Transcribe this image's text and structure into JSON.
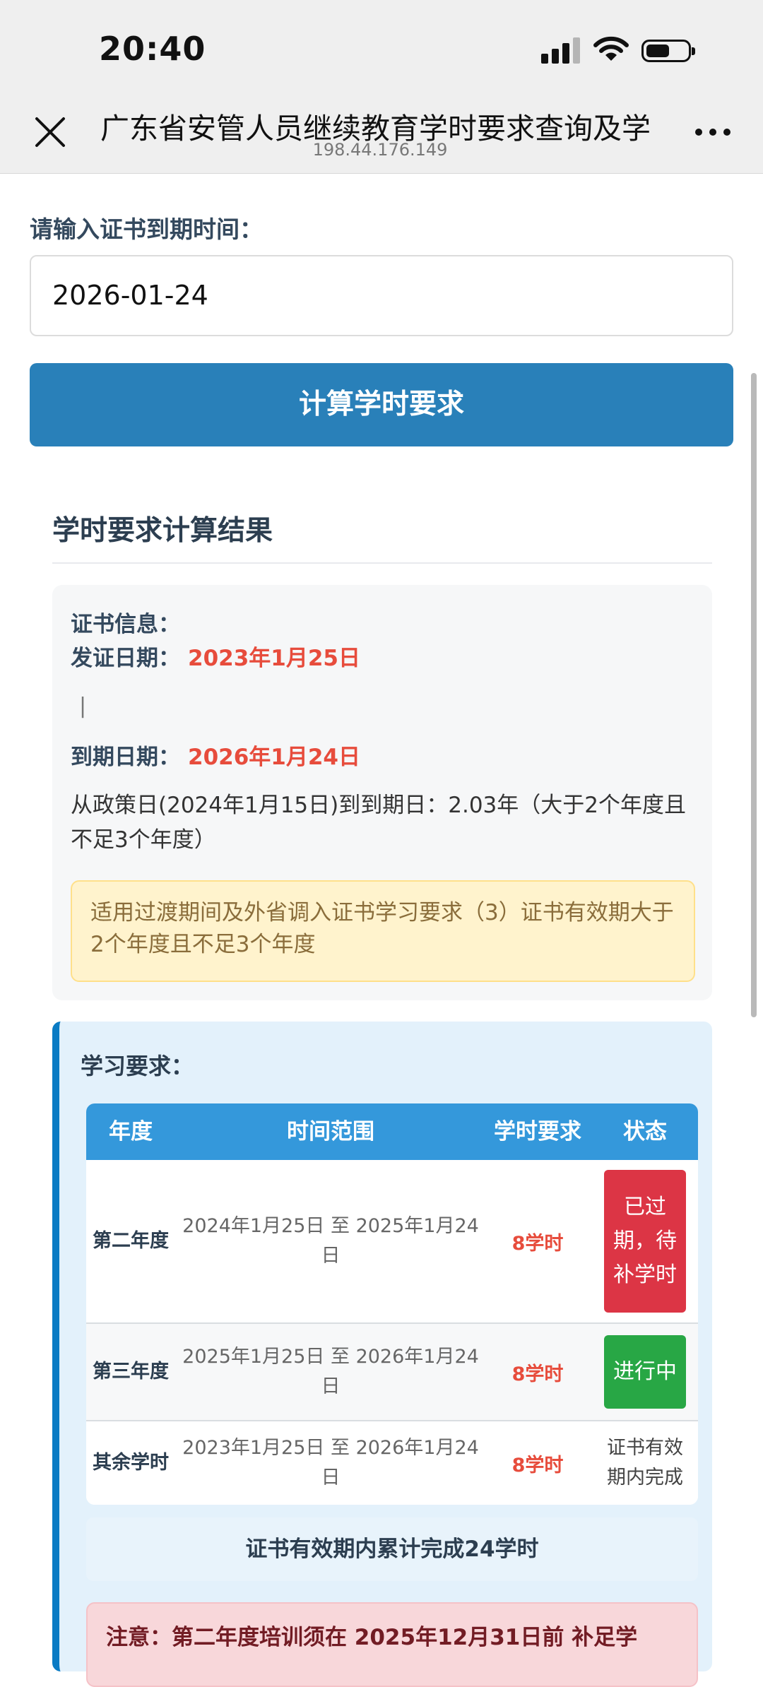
{
  "status_bar": {
    "time": "20:40"
  },
  "browser": {
    "title": "广东省安管人员继续教育学时要求查询及学",
    "url": "198.44.176.149"
  },
  "form": {
    "label": "请输入证书到期时间：",
    "date_value": "2026-01-24",
    "submit_label": "计算学时要求"
  },
  "result": {
    "title": "学时要求计算结果",
    "cert": {
      "heading": "证书信息：",
      "issue_label": "发证日期：",
      "issue_date": "2023年1月25日",
      "separator": "|",
      "expiry_label": "到期日期：",
      "expiry_date": "2026年1月24日",
      "policy_text": "从政策日(2024年1月15日)到到期日：2.03年（大于2个年度且不足3个年度）",
      "warning": "适用过渡期间及外省调入证书学习要求（3）证书有效期大于2个年度且不足3个年度"
    },
    "study": {
      "heading": "学习要求：",
      "columns": [
        "年度",
        "时间范围",
        "学时要求",
        "状态"
      ],
      "rows": [
        {
          "year": "第二年度",
          "range": "2024年1月25日 至 2025年1月24日",
          "hours": "8学时",
          "status": "已过期，待补学时"
        },
        {
          "year": "第三年度",
          "range": "2025年1月25日 至 2026年1月24日",
          "hours": "8学时",
          "status": "进行中"
        },
        {
          "year": "其余学时",
          "range": "2023年1月25日 至 2026年1月24日",
          "hours": "8学时",
          "status": "证书有效期内完成"
        }
      ],
      "total": "证书有效期内累计完成24学时",
      "note": "注意：第二年度培训须在 2025年12月31日前 补足学"
    }
  },
  "colors": {
    "primary_button": "#2980b9",
    "table_header": "#3498db",
    "accent_red": "#e74c3c",
    "status_expired": "#dc3545",
    "status_active": "#28a745",
    "warning_bg": "#fff3cd",
    "note_bg": "#f8d7da"
  }
}
